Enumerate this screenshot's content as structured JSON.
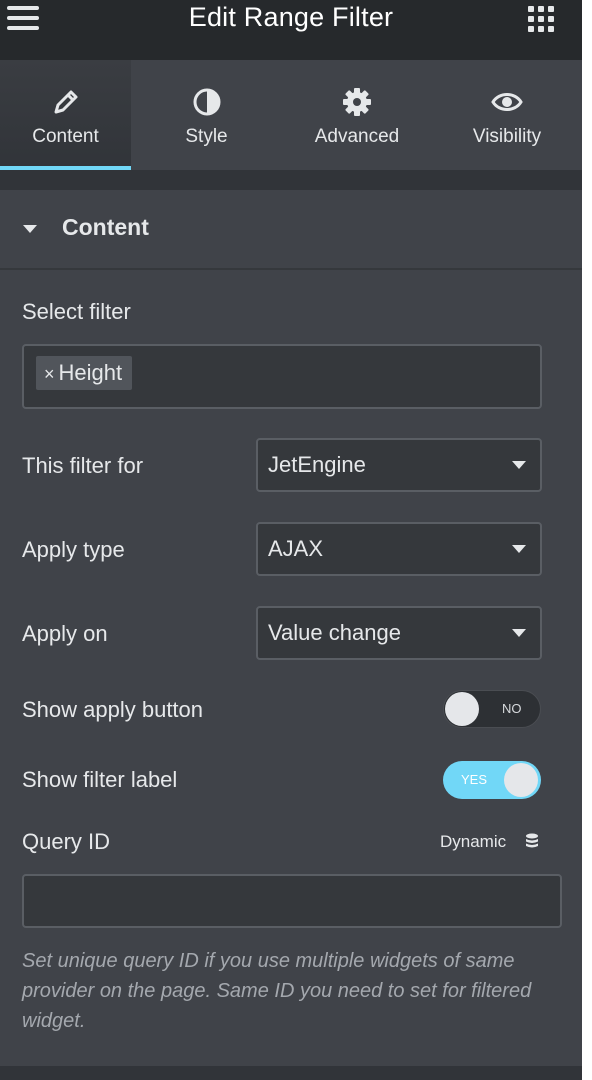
{
  "header": {
    "title": "Edit Range Filter",
    "menu_icon": "hamburger-icon",
    "apps_icon": "grid-icon"
  },
  "tabs": [
    {
      "label": "Content",
      "icon": "pencil-icon",
      "active": true
    },
    {
      "label": "Style",
      "icon": "half-circle-icon",
      "active": false
    },
    {
      "label": "Advanced",
      "icon": "gear-icon",
      "active": false
    },
    {
      "label": "Visibility",
      "icon": "eye-icon",
      "active": false
    }
  ],
  "section": {
    "title": "Content"
  },
  "fields": {
    "select_filter": {
      "label": "Select filter",
      "tags": [
        "Height"
      ],
      "remove_glyph": "×"
    },
    "filter_for": {
      "label": "This filter for",
      "value": "JetEngine"
    },
    "apply_type": {
      "label": "Apply type",
      "value": "AJAX"
    },
    "apply_on": {
      "label": "Apply on",
      "value": "Value change"
    },
    "show_apply_button": {
      "label": "Show apply button",
      "state": "NO"
    },
    "show_filter_label": {
      "label": "Show filter label",
      "state": "YES"
    },
    "query_id": {
      "label": "Query ID",
      "dynamic_label": "Dynamic",
      "value": "",
      "description": "Set unique query ID if you use multiple widgets of same provider on the page. Same ID you need to set for filtered widget."
    }
  },
  "colors": {
    "accent": "#71d7f7",
    "panel_bg": "#404349",
    "header_bg": "#26292c"
  }
}
